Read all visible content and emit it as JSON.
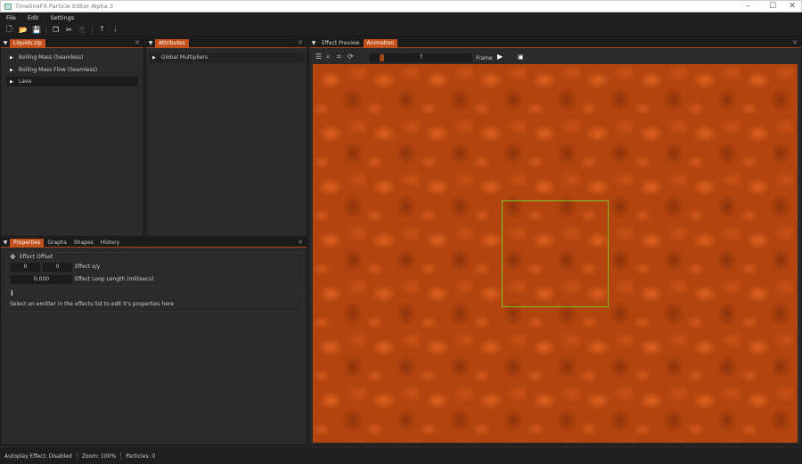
{
  "window": {
    "title": "TimelineFX Particle Editor Alpha 3"
  },
  "menu": [
    "File",
    "Edit",
    "Settings"
  ],
  "toolbar": {
    "icons": [
      "new-file",
      "open-folder",
      "save",
      "copy",
      "cut",
      "paste",
      "move-up",
      "move-down"
    ],
    "glyphs": [
      "🗋",
      "📂",
      "💾",
      "❐",
      "✂",
      "⎘",
      "🡑",
      "🡓"
    ]
  },
  "library": {
    "tab": "Liquids.zip",
    "items": [
      "Boiling Mass (Seamless)",
      "Boiling Mass Flow (Seamless)",
      "Lava"
    ],
    "selected": "Lava"
  },
  "attributes": {
    "tab": "Attributes",
    "items": [
      "Global Multipliers"
    ]
  },
  "properties": {
    "tabs": [
      "Properties",
      "Graphs",
      "Shapes",
      "History"
    ],
    "active": "Properties",
    "offset_title": "Effect Offset",
    "x": "0",
    "y": "0",
    "xy_label": "Effect x/y",
    "loop": "0.000",
    "loop_label": "Effect Loop Length (millisecs)",
    "info": "Select an emitter in the effects list to edit it's properties here"
  },
  "preview": {
    "tabs": [
      "Effect Preview",
      "Animation"
    ],
    "active": "Animation",
    "frame": "7",
    "frame_label": "Frame",
    "frame_progress": 0.03
  },
  "status": {
    "autoplay": "Autoplay Effect: Disabled",
    "zoom": "Zoom: 100%",
    "particles": "Particles: 0"
  },
  "colors": {
    "accent": "#c4501c",
    "selection": "#7dc21e"
  }
}
